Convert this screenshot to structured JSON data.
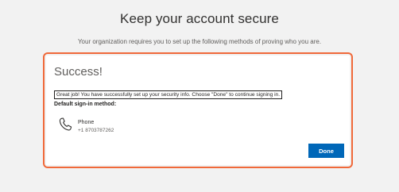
{
  "header": {
    "title": "Keep your account secure",
    "subtitle": "Your organization requires you to set up the following methods of proving who you are."
  },
  "card": {
    "heading": "Success!",
    "message": "Great job! You have successfully set up your security info. Choose \"Done\" to continue signing in.",
    "default_method_label": "Default sign-in method:",
    "method": {
      "icon": "phone-icon",
      "name": "Phone",
      "value": "+1 8703787262"
    },
    "done_label": "Done"
  },
  "colors": {
    "highlight": "#f0693a",
    "primary_button": "#0067b8",
    "background": "#f2f2f2"
  }
}
